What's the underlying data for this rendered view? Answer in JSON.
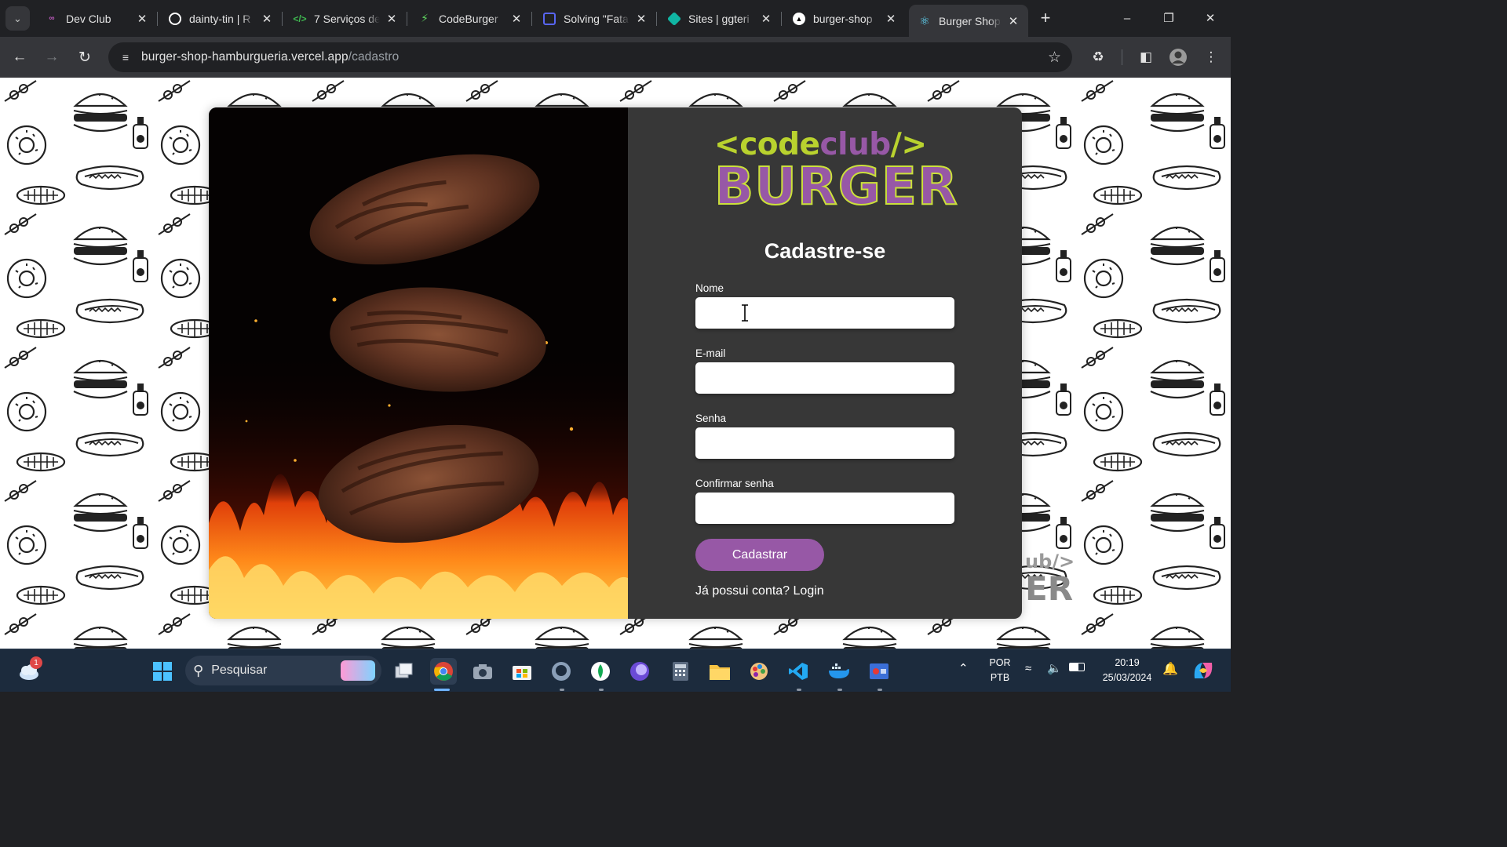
{
  "browser": {
    "tabs": [
      {
        "title": "Dev Club",
        "icon": "devclub-icon",
        "color": "#8a3f8f"
      },
      {
        "title": "dainty-tin | R",
        "icon": "replit-icon",
        "color": "#ffffff"
      },
      {
        "title": "7 Serviços de",
        "icon": "code-icon",
        "color": "#3fb950"
      },
      {
        "title": "CodeBurger",
        "icon": "bolt-icon",
        "color": "#5fd45f"
      },
      {
        "title": "Solving \"Fata",
        "icon": "chat-icon",
        "color": "#5865f2"
      },
      {
        "title": "Sites | ggteri",
        "icon": "diamond-icon",
        "color": "#10b5a3"
      },
      {
        "title": "burger-shop",
        "icon": "vercel-icon",
        "color": "#ffffff"
      },
      {
        "title": "Burger Shop",
        "icon": "react-icon",
        "color": "#61dafb",
        "active": true
      }
    ],
    "url_host": "burger-shop-hamburgueria.vercel.app",
    "url_path": "/cadastro"
  },
  "brand": {
    "line1_left": "<",
    "line1_code": "code",
    "line1_club": "club",
    "line1_right": "/>",
    "line2": "BURGER",
    "colors": {
      "purple": "#9758a6",
      "green": "#b9d22e"
    }
  },
  "form": {
    "title": "Cadastre-se",
    "name_label": "Nome",
    "email_label": "E-mail",
    "password_label": "Senha",
    "confirm_label": "Confirmar senha",
    "name_value": "",
    "email_value": "",
    "password_value": "",
    "confirm_value": "",
    "submit_label": "Cadastrar",
    "login_prompt": "Já possui conta? Login"
  },
  "background_watermark": {
    "line1": "ub/>",
    "line2": "ER"
  },
  "taskbar": {
    "search_placeholder": "Pesquisar",
    "weather_badge": "1",
    "language_top": "POR",
    "language_bottom": "PTB",
    "time": "20:19",
    "date": "25/03/2024"
  }
}
